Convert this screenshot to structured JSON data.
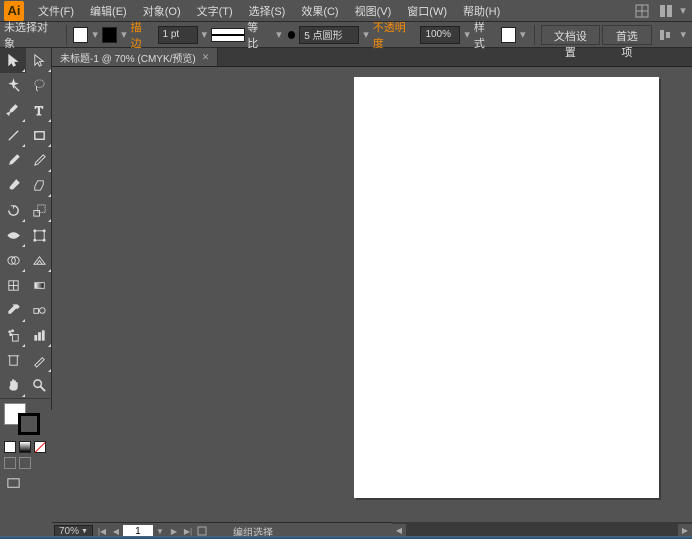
{
  "menubar": {
    "items": [
      "文件(F)",
      "编辑(E)",
      "对象(O)",
      "文字(T)",
      "选择(S)",
      "效果(C)",
      "视图(V)",
      "窗口(W)",
      "帮助(H)"
    ]
  },
  "controlbar": {
    "no_selection": "未选择对象",
    "stroke_label": "描边",
    "stroke_weight": "1 pt",
    "stroke_profile": "等比",
    "brush_def": "5 点圆形",
    "opacity_label": "不透明度",
    "opacity_value": "100%",
    "style_label": "样式",
    "doc_setup": "文档设置",
    "prefs": "首选项"
  },
  "tab": {
    "title": "未标题-1 @ 70% (CMYK/预览)"
  },
  "status": {
    "zoom": "70%",
    "page": "1",
    "mode": "编组选择"
  },
  "tool_names": [
    "selection-tool",
    "direct-selection-tool",
    "magic-wand-tool",
    "lasso-tool",
    "pen-tool",
    "type-tool",
    "line-segment-tool",
    "rectangle-tool",
    "paintbrush-tool",
    "pencil-tool",
    "blob-brush-tool",
    "eraser-tool",
    "rotate-tool",
    "scale-tool",
    "width-tool",
    "free-transform-tool",
    "shape-builder-tool",
    "perspective-grid-tool",
    "mesh-tool",
    "gradient-tool",
    "eyedropper-tool",
    "blend-tool",
    "symbol-sprayer-tool",
    "column-graph-tool",
    "artboard-tool",
    "slice-tool",
    "hand-tool",
    "zoom-tool"
  ]
}
